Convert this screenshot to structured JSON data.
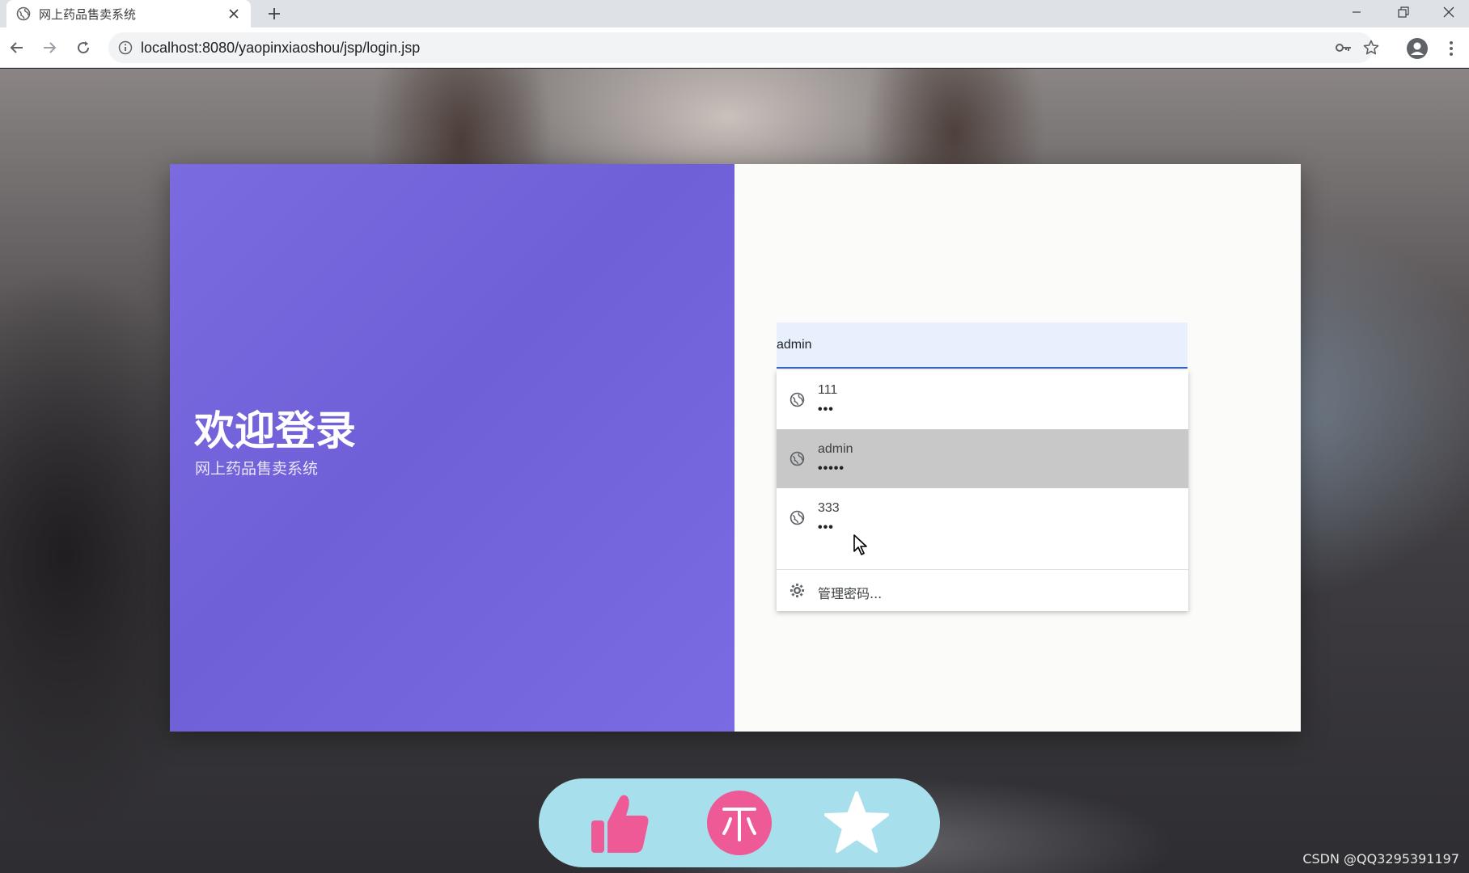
{
  "browser": {
    "tab_title": "网上药品售卖系统",
    "url": "localhost:8080/yaopinxiaoshou/jsp/login.jsp"
  },
  "page": {
    "welcome": "欢迎登录",
    "subtitle": "网上药品售卖系统",
    "username_value": "admin"
  },
  "autofill": {
    "entries": [
      {
        "username": "111",
        "password_mask": "•••",
        "selected": false
      },
      {
        "username": "admin",
        "password_mask": "•••••",
        "selected": true
      },
      {
        "username": "333",
        "password_mask": "•••",
        "selected": false
      }
    ],
    "manage_label": "管理密码..."
  },
  "action_bar": {
    "icons": [
      "thumbs-up-icon",
      "coin-icon",
      "star-icon"
    ],
    "accent_color": "#ee5a96",
    "background_color": "#a7dfec"
  },
  "watermark": "CSDN @QQ3295391197",
  "colors": {
    "left_panel": "#7566dd",
    "field_bg": "#e8f0fe",
    "selected_row": "#c8c8c8"
  }
}
